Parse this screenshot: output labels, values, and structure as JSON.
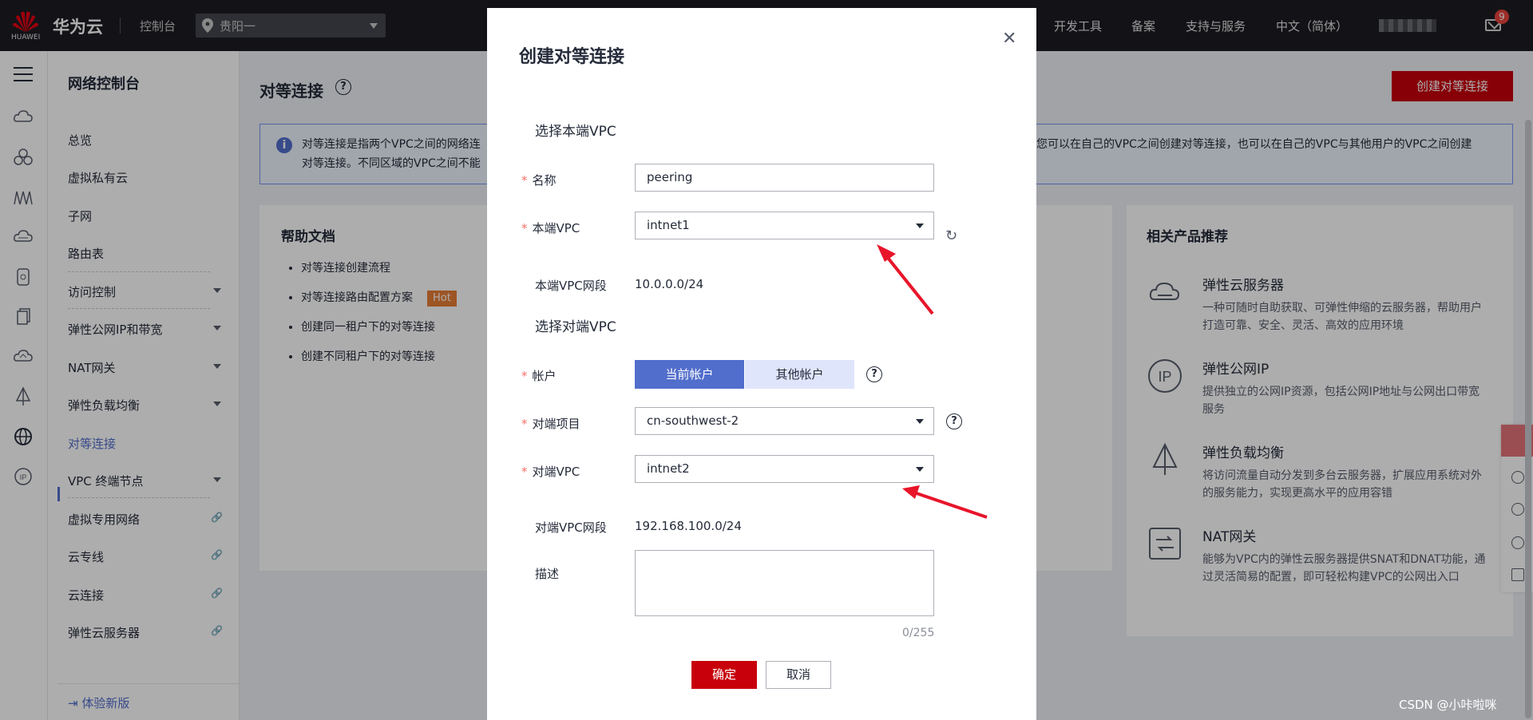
{
  "topbar": {
    "logo_text": "HUAWEI",
    "brand": "华为云",
    "console": "控制台",
    "region": "贵阳一",
    "nav": [
      "开发工具",
      "备案",
      "支持与服务",
      "中文（简体）"
    ],
    "mail_badge": "9"
  },
  "sidenav": {
    "title": "网络控制台",
    "items": [
      {
        "label": "总览"
      },
      {
        "label": "虚拟私有云"
      },
      {
        "label": "子网"
      },
      {
        "label": "路由表"
      },
      {
        "label": "访问控制"
      },
      {
        "label": "弹性公网IP和带宽"
      },
      {
        "label": "NAT网关"
      },
      {
        "label": "弹性负载均衡"
      },
      {
        "label": "对等连接"
      },
      {
        "label": "VPC 终端节点"
      },
      {
        "label": "虚拟专用网络"
      },
      {
        "label": "云专线"
      },
      {
        "label": "云连接"
      },
      {
        "label": "弹性云服务器"
      }
    ],
    "try_new": "体验新版"
  },
  "main": {
    "page_title": "对等连接",
    "create_button": "创建对等连接",
    "notice_line1": "对等连接是指两个VPC之间的网络连",
    "notice_line2": "对等连接。不同区域的VPC之间不能",
    "notice_line1_right": "您可以在自己的VPC之间创建对等连接，也可以在自己的VPC与其他用户的VPC之间创建",
    "help_title": "帮助文档",
    "help_links": [
      "对等连接创建流程",
      "对等连接路由配置方案",
      "创建同一租户下的对等连接",
      "创建不同租户下的对等连接"
    ],
    "hot_label": "Hot",
    "rec_title": "相关产品推荐",
    "rec_items": [
      {
        "name": "弹性云服务器",
        "desc": "一种可随时自助获取、可弹性伸缩的云服务器，帮助用户打造可靠、安全、灵活、高效的应用环境"
      },
      {
        "name": "弹性公网IP",
        "desc": "提供独立的公网IP资源，包括公网IP地址与公网出口带宽服务"
      },
      {
        "name": "弹性负载均衡",
        "desc": "将访问流量自动分发到多台云服务器，扩展应用系统对外的服务能力，实现更高水平的应用容错"
      },
      {
        "name": "NAT网关",
        "desc": "能够为VPC内的弹性云服务器提供SNAT和DNAT功能，通过灵活简易的配置，即可轻松构建VPC的公网出入口"
      }
    ]
  },
  "dialog": {
    "title": "创建对等连接",
    "section_local": "选择本端VPC",
    "section_peer": "选择对端VPC",
    "name_label": "名称",
    "name_value": "peering",
    "local_vpc_label": "本端VPC",
    "local_vpc_value": "intnet1",
    "local_cidr_label": "本端VPC网段",
    "local_cidr_value": "10.0.0.0/24",
    "account_label": "帐户",
    "account_current": "当前帐户",
    "account_other": "其他帐户",
    "project_label": "对端项目",
    "project_value": "cn-southwest-2",
    "peer_vpc_label": "对端VPC",
    "peer_vpc_value": "intnet2",
    "peer_cidr_label": "对端VPC网段",
    "peer_cidr_value": "192.168.100.0/24",
    "desc_label": "描述",
    "desc_counter": "0/255",
    "ok": "确定",
    "cancel": "取消"
  },
  "watermark": "CSDN @小咔啦咪",
  "colors": {
    "primary_red": "#c7000b",
    "accent_blue": "#526ecc",
    "annotation_arrow": "#e8152a"
  }
}
